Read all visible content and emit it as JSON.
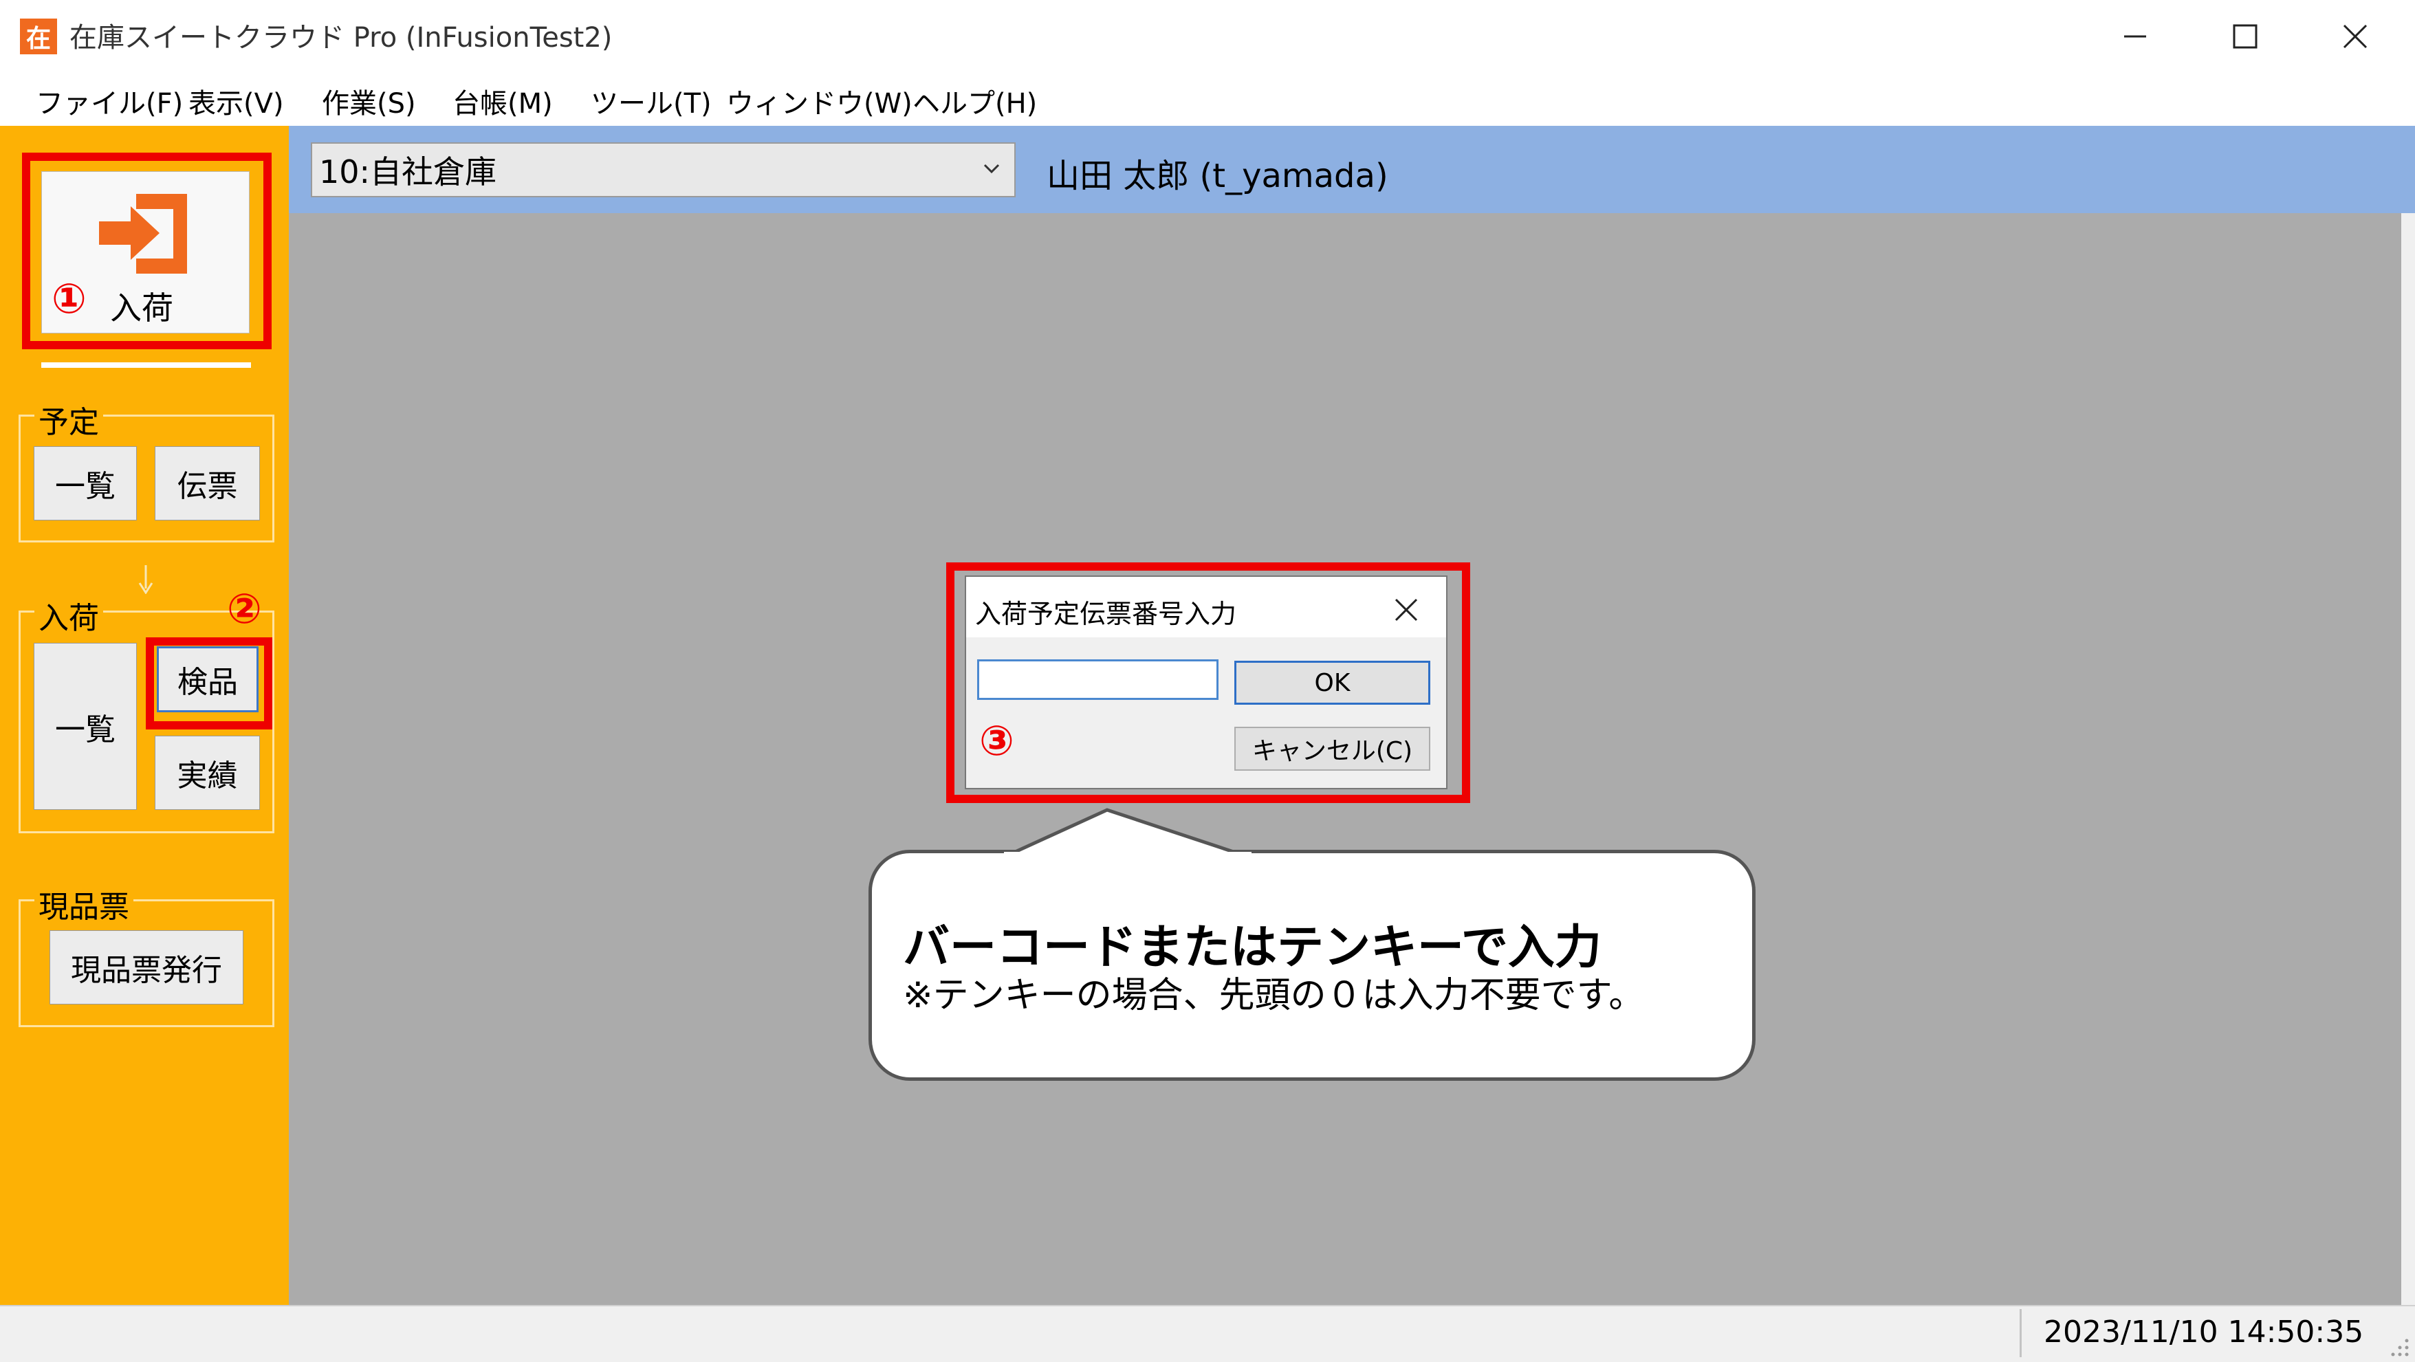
{
  "window": {
    "app_icon_glyph": "在",
    "title": "在庫スイートクラウド Pro (InFusionTest2)"
  },
  "menu": [
    {
      "label": "ファイル(F)"
    },
    {
      "label": "表示(V)"
    },
    {
      "label": "作業(S)"
    },
    {
      "label": "台帳(M)"
    },
    {
      "label": "ツール(T)"
    },
    {
      "label": "ウィンドウ(W)"
    },
    {
      "label": "ヘルプ(H)"
    }
  ],
  "sidebar": {
    "main_button": {
      "label": "入荷",
      "icon": "enter-icon",
      "marker": "①"
    },
    "schedule": {
      "label": "予定",
      "list_button": "一覧",
      "slip_button": "伝票"
    },
    "arrival": {
      "label": "入荷",
      "list_button": "一覧",
      "inspect_button": "検品",
      "result_button": "実績",
      "marker": "②"
    },
    "ticket": {
      "label": "現品票",
      "issue_button": "現品票発行"
    }
  },
  "header": {
    "warehouse": "10:自社倉庫",
    "user": "山田 太郎 (t_yamada)"
  },
  "dialog": {
    "title": "入荷予定伝票番号入力",
    "input_value": "",
    "ok_label": "OK",
    "cancel_label": "キャンセル(C)",
    "marker": "③"
  },
  "callout": {
    "title": "バーコードまたはテンキーで入力",
    "note": "※テンキーの場合、先頭の０は入力不要です。"
  },
  "status": {
    "datetime": "2023/11/10  14:50:35"
  },
  "colors": {
    "sidebar": "#fdb105",
    "header_strip": "#8db0e2",
    "workarea": "#ababab",
    "annotation_red": "#ee0000",
    "icon_orange": "#f06a1f"
  }
}
